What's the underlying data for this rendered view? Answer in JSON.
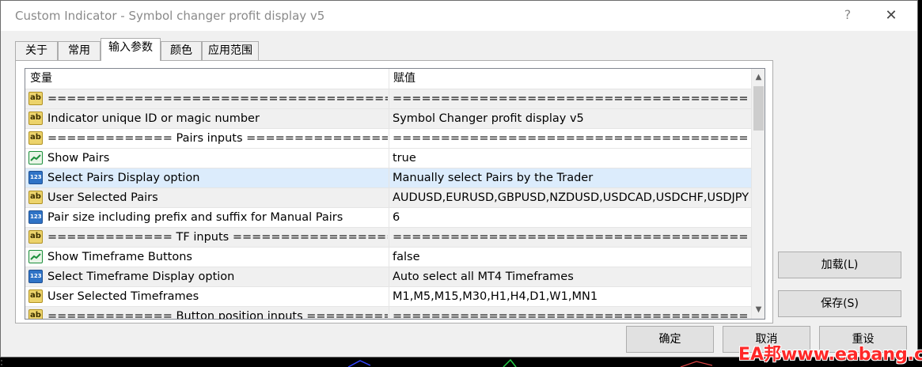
{
  "window": {
    "title": "Custom Indicator - Symbol changer profit display v5",
    "help_label": "?",
    "close_label": "✕"
  },
  "tabs": [
    {
      "label": "关于"
    },
    {
      "label": "常用"
    },
    {
      "label": "输入参数"
    },
    {
      "label": "颜色"
    },
    {
      "label": "应用范围"
    }
  ],
  "table": {
    "headers": {
      "variable": "变量",
      "value": "赋值"
    },
    "rows": [
      {
        "type": "ab",
        "variable": "=====================================================",
        "value": "=========================================================="
      },
      {
        "type": "ab",
        "variable": "Indicator unique ID or magic number",
        "value": "Symbol Changer profit display v5"
      },
      {
        "type": "ab",
        "variable": "============= Pairs inputs ===============================",
        "value": "=========================================================="
      },
      {
        "type": "bool",
        "variable": "Show Pairs",
        "value": "true"
      },
      {
        "type": "num",
        "variable": "Select Pairs Display option",
        "value": "Manually select Pairs by the Trader"
      },
      {
        "type": "ab",
        "variable": "User Selected Pairs",
        "value": "AUDUSD,EURUSD,GBPUSD,NZDUSD,USDCAD,USDCHF,USDJPY"
      },
      {
        "type": "num",
        "variable": "Pair size including prefix and suffix for Manual Pairs",
        "value": "6"
      },
      {
        "type": "ab",
        "variable": "============= TF inputs ==================================",
        "value": "=========================================================="
      },
      {
        "type": "bool",
        "variable": "Show Timeframe Buttons",
        "value": "false"
      },
      {
        "type": "num",
        "variable": "Select Timeframe Display option",
        "value": "Auto select all MT4 Timeframes"
      },
      {
        "type": "ab",
        "variable": "User Selected Timeframes",
        "value": "M1,M5,M15,M30,H1,H4,D1,W1,MN1"
      },
      {
        "type": "ab",
        "variable": "============= Button position inputs ===========",
        "value": "=========================================================="
      }
    ]
  },
  "icons": {
    "ab": "ab",
    "num": "123"
  },
  "scrollbar": {
    "up": "▲",
    "down": "▼"
  },
  "buttons": {
    "load": "加载(L)",
    "save": "保存(S)",
    "ok": "确定",
    "cancel": "取消",
    "reset": "重设"
  },
  "watermark": "EA邦www.eabang.com",
  "colors": {
    "selected_row": "#dcecfc",
    "alt_row": "#f0f0f0",
    "watermark": "#ff2828"
  }
}
